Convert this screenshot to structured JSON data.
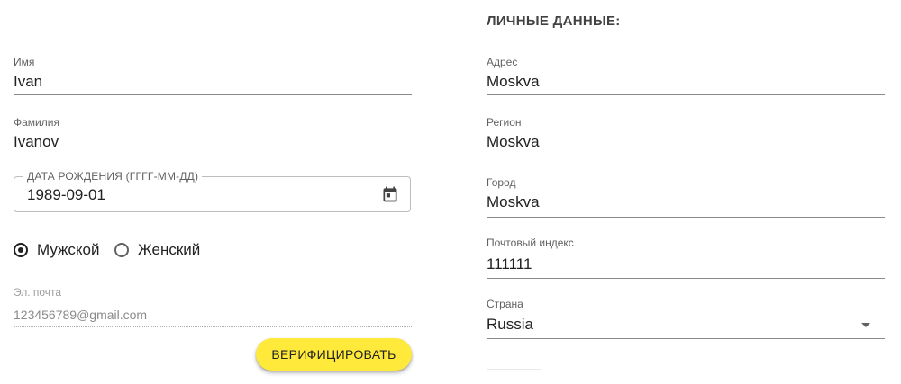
{
  "personal": {
    "first_name": {
      "label": "Имя",
      "value": "Ivan"
    },
    "last_name": {
      "label": "Фамилия",
      "value": "Ivanov"
    },
    "birth_date": {
      "label": "ДАТА РОЖДЕНИЯ (ГГГГ-ММ-ДД)",
      "value": "1989-09-01",
      "icon": "calendar-icon"
    },
    "gender": {
      "options": [
        {
          "label": "Мужской",
          "checked": true
        },
        {
          "label": "Женский",
          "checked": false
        }
      ]
    },
    "email": {
      "label": "Эл. почта",
      "value": "123456789@gmail.com",
      "disabled": true
    },
    "verify_button": "ВЕРИФИЦИРОВАТЬ"
  },
  "personal_data": {
    "title": "ЛИЧНЫЕ ДАННЫЕ:",
    "address": {
      "label": "Адрес",
      "value": "Moskva"
    },
    "region": {
      "label": "Регион",
      "value": "Moskva"
    },
    "city": {
      "label": "Город",
      "value": "Moskva"
    },
    "postal_code": {
      "label": "Почтовый индекс",
      "value": "111111"
    },
    "country": {
      "label": "Страна",
      "value": "Russia",
      "icon": "dropdown-arrow-icon"
    }
  },
  "colors": {
    "button_bg": "#ffe93a",
    "text": "#212121",
    "label": "#616161",
    "underline": "#8a8a8a"
  }
}
